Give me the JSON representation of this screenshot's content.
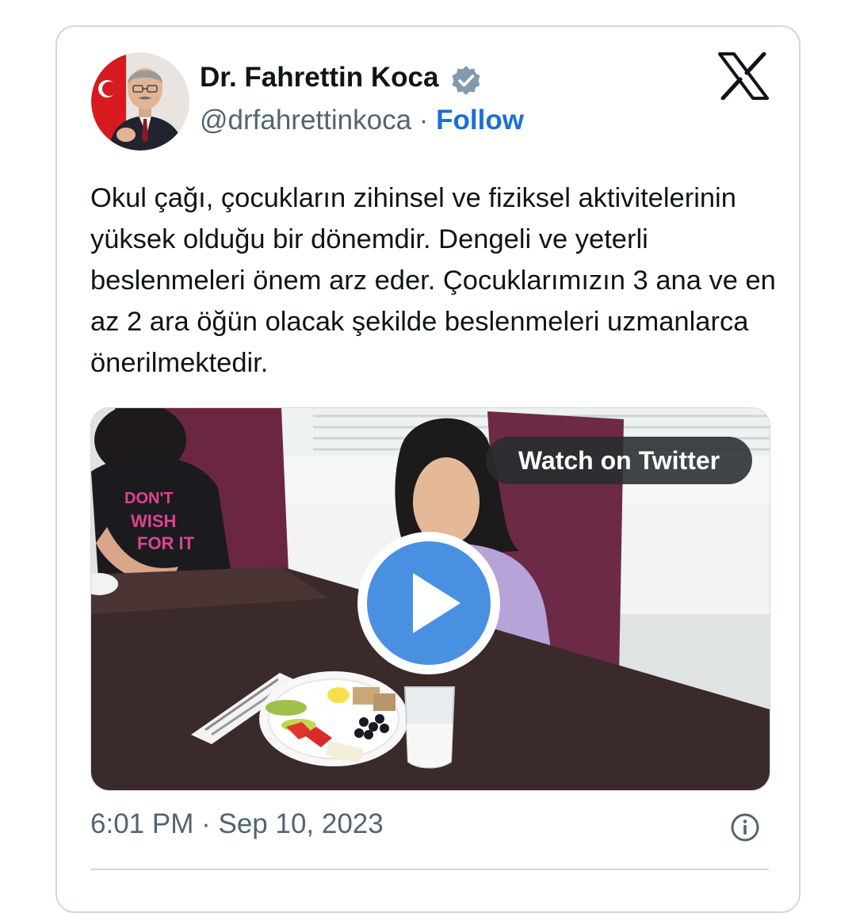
{
  "tweet": {
    "author_name": "Dr. Fahrettin Koca",
    "author_handle": "@drfahrettinkoca",
    "separator": "·",
    "follow_label": "Follow",
    "text": "Okul çağı, çocukların zihinsel ve fiziksel aktivitelerinin yüksek olduğu bir dönemdir. Dengeli ve yeterli beslenmeleri önem arz eder. Çocuklarımızın 3 ana ve en az 2 ara öğün olacak şekilde beslenmeleri uzmanlarca önerilmektedir.",
    "media": {
      "watch_label": "Watch on Twitter"
    },
    "time": "6:01 PM",
    "date": "Sep 10, 2023"
  },
  "icons": {
    "verified": "verified-badge-icon",
    "platform": "x-logo-icon",
    "play": "play-icon",
    "info": "info-icon"
  },
  "colors": {
    "follow": "#1d6fd6",
    "muted_text": "#536471",
    "play_button": "#4a90e2",
    "border": "#cfd9de"
  }
}
